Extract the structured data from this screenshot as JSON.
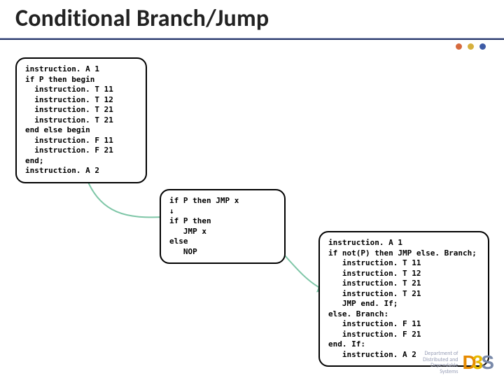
{
  "title": "Conditional Branch/Jump",
  "box1": "instruction. A 1\nif P then begin\n  instruction. T 11\n  instruction. T 12\n  instruction. T 21\n  instruction. T 21\nend else begin\n  instruction. F 11\n  instruction. F 21\nend;\ninstruction. A 2",
  "box2": "if P then JMP x\n↓\nif P then\n   JMP x\nelse\n   NOP",
  "box3": "instruction. A 1\nif not(P) then JMP else. Branch;\n   instruction. T 11\n   instruction. T 12\n   instruction. T 21\n   instruction. T 21\n   JMP end. If;\nelse. Branch:\n   instruction. F 11\n   instruction. F 21\nend. If:\n   instruction. A 2",
  "footer": {
    "line1": "Department of",
    "line2": "Distributed and",
    "line3": "Dependable",
    "line4": "Systems"
  },
  "logo": {
    "d": "D",
    "three": "3",
    "s": "S"
  }
}
